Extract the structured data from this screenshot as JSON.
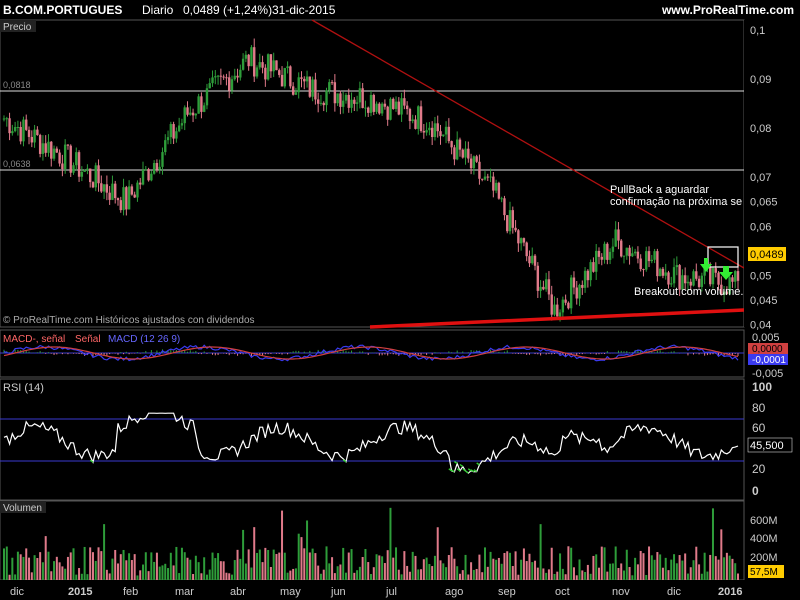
{
  "header": {
    "symbol": "B.COM.PORTUGUES",
    "period": "Diario",
    "quote": "0,0489 (+1,24%)",
    "date": "31-dic-2015",
    "site": "www.ProRealTime.com"
  },
  "colors": {
    "up": "#2e9d3a",
    "down": "#e07a8a",
    "trendline": "#b01010",
    "support": "#e01010",
    "macd_line": "#3a3af0",
    "signal_line": "#d04040",
    "rsi_line": "#ffffff",
    "volume_up": "#2e9d3a",
    "volume_down": "#e07a8a",
    "price_tag": "#ffcc00",
    "arrow": "#33ee33"
  },
  "panels": {
    "price": {
      "label": "Precio",
      "hline_high_label": "0,0818",
      "hline_low_label": "0,0638",
      "copyright": "© ProRealTime.com  Históricos ajustados con dividendos",
      "annotation_pullback_1": "PullBack a aguardar",
      "annotation_pullback_2": "confirmação na próxima se",
      "annotation_breakout": "Breakout com volume.",
      "last_price": "0,0489",
      "y_ticks": [
        "0,1",
        "0,09",
        "0,08",
        "0,07",
        "0,065",
        "0,06",
        "0,055",
        "0,05",
        "0,045",
        "0,04"
      ]
    },
    "macd": {
      "label_1": "MACD-, señal",
      "label_2": "Señal",
      "label_3": "MACD (12 26 9)",
      "y_ticks": [
        "0,005",
        "-0,005"
      ],
      "value_1": "0,0000",
      "value_2": "-0,0001"
    },
    "rsi": {
      "label": "RSI (14)",
      "y_ticks": [
        "100",
        "80",
        "60",
        "40",
        "20",
        "0"
      ],
      "value": "45,500"
    },
    "volume": {
      "label": "Volumen",
      "y_ticks": [
        "600M",
        "400M",
        "200M"
      ],
      "value": "57,5M"
    }
  },
  "x_axis": {
    "labels": [
      "dic",
      "2015",
      "feb",
      "mar",
      "abr",
      "may",
      "jun",
      "jul",
      "ago",
      "sep",
      "oct",
      "nov",
      "dic",
      "2016"
    ]
  },
  "chart_data": [
    {
      "type": "candlestick",
      "title": "B.COM.PORTUGUES Diario",
      "period": "2014-12 to 2015-12-31",
      "ylim": [
        0.04,
        0.1
      ],
      "x_labels": [
        "dic",
        "2015",
        "feb",
        "mar",
        "abr",
        "may",
        "jun",
        "jul",
        "ago",
        "sep",
        "oct",
        "nov",
        "dic",
        "2016"
      ],
      "monthly_close_approx": [
        0.082,
        0.074,
        0.065,
        0.083,
        0.094,
        0.088,
        0.086,
        0.081,
        0.067,
        0.043,
        0.057,
        0.05,
        0.048
      ],
      "last_close": 0.0489,
      "horizontal_lines": [
        0.0818,
        0.0638
      ],
      "trendline": {
        "from": [
          0.112,
          "may"
        ],
        "to": [
          0.0452,
          "2016"
        ]
      },
      "support_line": {
        "from": [
          0.0397,
          "jun"
        ],
        "to": [
          0.0408,
          "2016"
        ]
      }
    },
    {
      "type": "line",
      "title": "MACD (12 26 9)",
      "ylim": [
        -0.005,
        0.005
      ],
      "last_values": [
        0.0,
        -0.0001
      ]
    },
    {
      "type": "line",
      "title": "RSI (14)",
      "ylim": [
        0,
        100
      ],
      "bands": [
        70,
        30
      ],
      "last_value": 45.5
    },
    {
      "type": "bar",
      "title": "Volumen",
      "ylim": [
        0,
        700000000
      ],
      "last_value": 57500000
    }
  ]
}
